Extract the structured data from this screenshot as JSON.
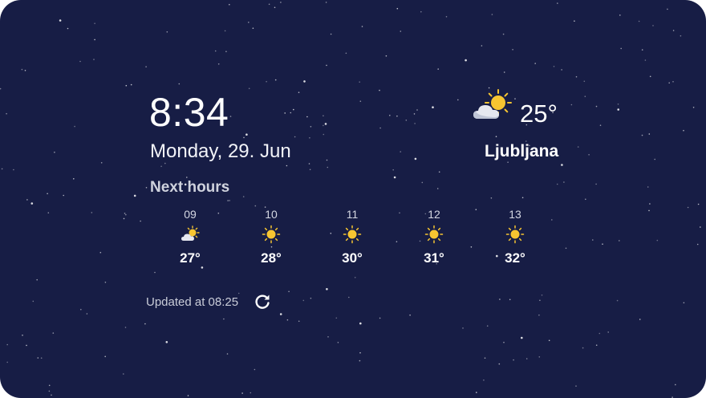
{
  "clock": {
    "time": "8:34",
    "date": "Monday, 29. Jun"
  },
  "current": {
    "icon": "partly-cloudy-icon",
    "temperature": "25°",
    "city": "Ljubljana"
  },
  "forecast": {
    "title": "Next hours",
    "hours": [
      {
        "hour": "09",
        "icon": "partly-cloudy-icon",
        "temp": "27°"
      },
      {
        "hour": "10",
        "icon": "sun-icon",
        "temp": "28°"
      },
      {
        "hour": "11",
        "icon": "sun-icon",
        "temp": "30°"
      },
      {
        "hour": "12",
        "icon": "sun-icon",
        "temp": "31°"
      },
      {
        "hour": "13",
        "icon": "sun-icon",
        "temp": "32°"
      }
    ]
  },
  "status": {
    "updated": "Updated at 08:25",
    "refresh_icon": "refresh-icon"
  },
  "colors": {
    "background": "#171d45",
    "sun": "#f7c531",
    "text": "#ffffff"
  }
}
